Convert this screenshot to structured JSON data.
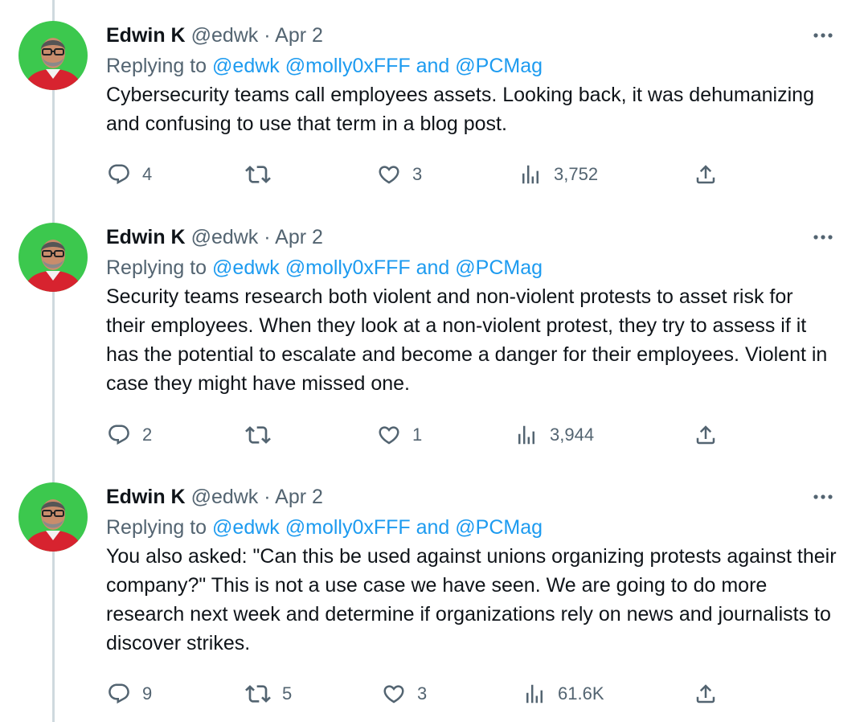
{
  "tweets": [
    {
      "author_name": "Edwin K",
      "handle": "@edwk",
      "separator": "·",
      "date": "Apr 2",
      "replying_prefix": "Replying to",
      "mention_1": "@edwk",
      "mention_2": "@molly0xFFF",
      "conjunction": "and",
      "mention_3": "@PCMag",
      "text": "Cybersecurity teams call employees assets. Looking back, it was dehumanizing and confusing to use that term in a blog post.",
      "replies": "4",
      "retweets": "",
      "likes": "3",
      "views": "3,752"
    },
    {
      "author_name": "Edwin K",
      "handle": "@edwk",
      "separator": "·",
      "date": "Apr 2",
      "replying_prefix": "Replying to",
      "mention_1": "@edwk",
      "mention_2": "@molly0xFFF",
      "conjunction": "and",
      "mention_3": "@PCMag",
      "text": "Security teams research both violent and non-violent protests to asset risk for their employees. When they look at a non-violent protest, they try to assess if it has the potential to escalate and become a danger for their employees. Violent in case they might have missed one.",
      "replies": "2",
      "retweets": "",
      "likes": "1",
      "views": "3,944"
    },
    {
      "author_name": "Edwin K",
      "handle": "@edwk",
      "separator": "·",
      "date": "Apr 2",
      "replying_prefix": "Replying to",
      "mention_1": "@edwk",
      "mention_2": "@molly0xFFF",
      "conjunction": "and",
      "mention_3": "@PCMag",
      "text": "You also asked: \"Can this be used against unions organizing protests against their company?\" This is not a use case we have seen. We are going to do more research next week and determine if organizations rely on news and journalists to discover strikes.",
      "replies": "9",
      "retweets": "5",
      "likes": "3",
      "views": "61.6K"
    }
  ],
  "icons": {
    "more": "more-horizontal-icon",
    "reply": "reply-icon",
    "retweet": "retweet-icon",
    "like": "heart-icon",
    "views": "views-chart-icon",
    "share": "share-icon"
  },
  "colors": {
    "link": "#1d9bf0",
    "secondary_text": "#536471",
    "primary_text": "#0f1419",
    "thread_line": "#cfd9de",
    "avatar_background": "#3cc84e"
  }
}
